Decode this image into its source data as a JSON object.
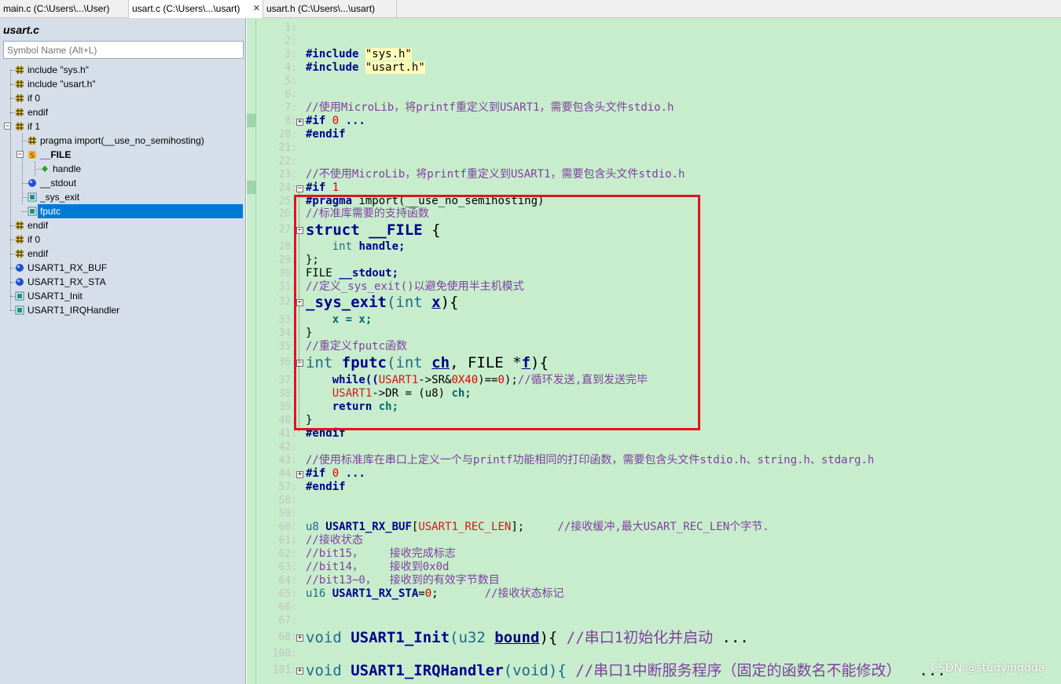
{
  "tabs": [
    {
      "label": "main.c (C:\\Users\\...\\User)",
      "active": false
    },
    {
      "label": "usart.c (C:\\Users\\...\\usart)",
      "active": true,
      "close": "✕"
    },
    {
      "label": "usart.h (C:\\Users\\...\\usart)",
      "active": false
    }
  ],
  "sidebar": {
    "title": "usart.c",
    "search_placeholder": "Symbol Name (Alt+L)",
    "items": [
      {
        "label": "include \"sys.h\"",
        "icon": "hash-icon"
      },
      {
        "label": "include \"usart.h\"",
        "icon": "hash-icon"
      },
      {
        "label": "if 0",
        "icon": "hash-icon"
      },
      {
        "label": "endif",
        "icon": "hash-icon"
      },
      {
        "label": "if 1",
        "icon": "hash-icon",
        "expanded": true
      },
      {
        "label": "pragma import(__use_no_semihosting)",
        "icon": "hash-icon"
      },
      {
        "label": "__FILE",
        "icon": "struct-icon",
        "expanded": true
      },
      {
        "label": "handle",
        "icon": "member-icon"
      },
      {
        "label": "__stdout",
        "icon": "variable-icon"
      },
      {
        "label": "_sys_exit",
        "icon": "function-icon"
      },
      {
        "label": "fputc",
        "icon": "function-icon",
        "selected": true
      },
      {
        "label": "endif",
        "icon": "hash-icon"
      },
      {
        "label": "if 0",
        "icon": "hash-icon"
      },
      {
        "label": "endif",
        "icon": "hash-icon"
      },
      {
        "label": "USART1_RX_BUF",
        "icon": "variable-icon"
      },
      {
        "label": "USART1_RX_STA",
        "icon": "variable-icon"
      },
      {
        "label": "USART1_Init",
        "icon": "function-icon"
      },
      {
        "label": "USART1_IRQHandler",
        "icon": "function-icon"
      }
    ]
  },
  "editor": {
    "line_numbers": [
      "1:",
      "2:",
      "3:",
      "4:",
      "5:",
      "6:",
      "7:",
      "8:",
      "20:",
      "21:",
      "22:",
      "23:",
      "24:",
      "25:",
      "26:",
      "27:",
      "28:",
      "29:",
      "30:",
      "31:",
      "32:",
      "33:",
      "34:",
      "35:",
      "36:",
      "37:",
      "38:",
      "39:",
      "40:",
      "41:",
      "42:",
      "43:",
      "44:",
      "57:",
      "58:",
      "59:",
      "60:",
      "61:",
      "62:",
      "63:",
      "64:",
      "65:",
      "66:",
      "67:",
      "68:",
      "100:",
      "101:"
    ],
    "text": {
      "l3a": "#include ",
      "l3b": "\"sys.h\"",
      "l4a": "#include ",
      "l4b": "\"usart.h\"",
      "l7": "//使用MicroLib，将printf重定义到USART1，需要包含头文件stdio.h",
      "l8a": "#if ",
      "l8b": "0",
      "l8c": " ...",
      "l20": "#endif",
      "l23": "//不使用MicroLib，将printf重定义到USART1，需要包含头文件stdio.h",
      "l24a": "#if ",
      "l24b": "1",
      "l25a": "#pragma",
      "l25b": " import(__use_no_semihosting)",
      "l26": "//标准库需要的支持函数",
      "l27a": "struct ",
      "l27b": "__FILE",
      "l27c": " {",
      "l28a": "    int ",
      "l28b": "handle;",
      "l29": "};",
      "l30a": "FILE ",
      "l30b": "__stdout;",
      "l31": "//定义_sys_exit()以避免使用半主机模式",
      "l32a": "_sys_exit",
      "l32b": "(int ",
      "l32c": "x",
      "l32d": "){",
      "l33a": "    ",
      "l33b": "x = x;",
      "l34": "}",
      "l35": "//重定义fputc函数",
      "l36a": "int ",
      "l36b": "fputc",
      "l36c": "(int ",
      "l36d": "ch",
      "l36e": ", FILE *",
      "l36f": "f",
      "l36g": "){",
      "l37a": "    while((",
      "l37b": "USART1",
      "l37c": "->SR&",
      "l37d": "0X40",
      "l37e": ")==",
      "l37f": "0",
      "l37g": ");",
      "l37h": "//循环发送,直到发送完毕",
      "l38a": "    ",
      "l38b": "USART1",
      "l38c": "->DR = (u8) ",
      "l38d": "ch;",
      "l39a": "    return ",
      "l39b": "ch;",
      "l40": "}",
      "l41": "#endif",
      "l43": "//使用标准库在串口上定义一个与printf功能相同的打印函数，需要包含头文件stdio.h、string.h、stdarg.h",
      "l44a": "#if ",
      "l44b": "0",
      "l44c": " ...",
      "l57": "#endif",
      "l60a": "u8 ",
      "l60b": "USART1_RX_BUF",
      "l60c": "[",
      "l60d": "USART1_REC_LEN",
      "l60e": "];     ",
      "l60f": "//接收缓冲,最大USART_REC_LEN个字节.",
      "l61": "//接收状态",
      "l62": "//bit15，    接收完成标志",
      "l63": "//bit14，    接收到0x0d",
      "l64": "//bit13~0，  接收到的有效字节数目",
      "l65a": "u16 ",
      "l65b": "USART1_RX_STA",
      "l65c": "=",
      "l65d": "0",
      "l65e": ";       ",
      "l65f": "//接收状态标记",
      "l68a": "void ",
      "l68b": "USART1_Init",
      "l68c": "(u32 ",
      "l68d": "bound",
      "l68e": "){ ",
      "l68f": "//串口1初始化并启动",
      "l68g": " ...",
      "l101a": "void ",
      "l101b": "USART1_IRQHandler",
      "l101c": "(void){ ",
      "l101d": "//串口1中断服务程序（固定的函数名不能修改）",
      "l101e": "  ..."
    }
  },
  "watermark": "CSDN @studyingdda",
  "colors": {
    "editor_bg": "#c7edcc",
    "highlight_box": "#e0141e",
    "selection": "#0078d7"
  }
}
